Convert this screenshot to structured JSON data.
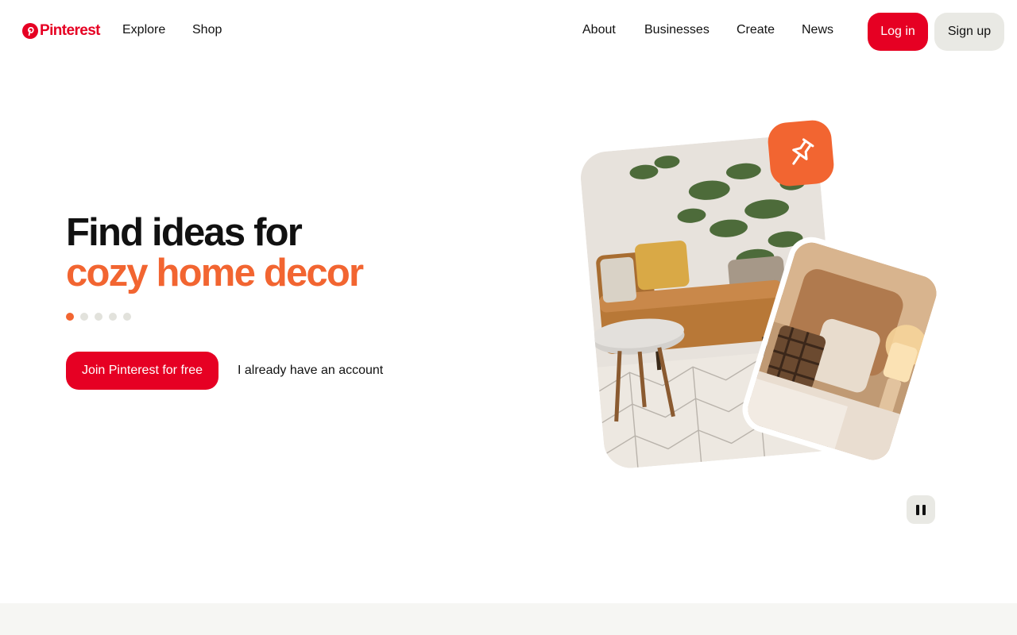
{
  "header": {
    "brand": "Pinterest",
    "nav_left": [
      "Explore",
      "Shop"
    ],
    "nav_right": [
      "About",
      "Businesses",
      "Create",
      "News"
    ],
    "login_label": "Log in",
    "signup_label": "Sign up"
  },
  "hero": {
    "headline_line1": "Find ideas for",
    "headline_line2": "cozy home decor",
    "carousel_total": 5,
    "carousel_active_index": 0,
    "join_label": "Join Pinterest for free",
    "account_label": "I already have an account"
  },
  "colors": {
    "brand_red": "#e60023",
    "accent_orange": "#f26531",
    "neutral_button": "#e9e9e4",
    "footer_band": "#f6f6f3"
  },
  "icons": {
    "logo": "pinterest-logo-icon",
    "badge": "pushpin-icon",
    "pause": "pause-icon"
  }
}
